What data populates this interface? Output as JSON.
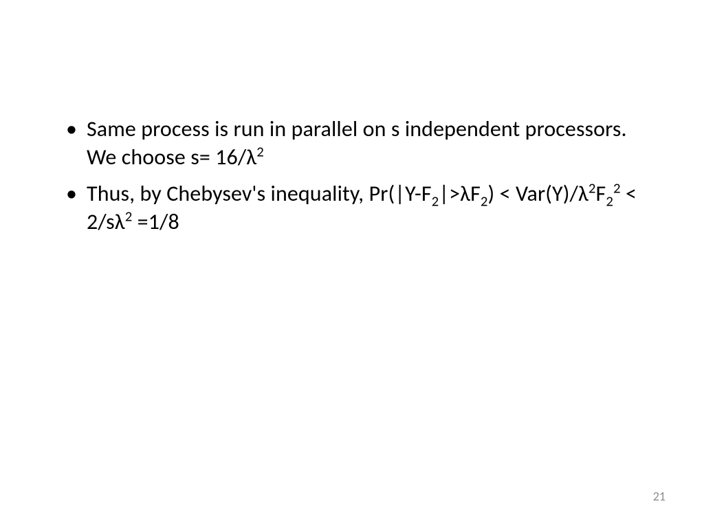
{
  "bullets": [
    {
      "b1_a": "Same process is run in parallel on s independent processors. We choose s= 16/λ",
      "b1_sup1": "2"
    },
    {
      "b2_a": "Thus, by Chebysev's inequality, Pr(|Y-F",
      "b2_sub1": "2",
      "b2_b": "|>λF",
      "b2_sub2": "2",
      "b2_c": ") < Var(Y)/λ",
      "b2_sup1": "2",
      "b2_d": "F",
      "b2_sub3": "2",
      "b2_sup2": "2",
      "b2_e": " < 2/sλ",
      "b2_sup3": "2",
      "b2_f": " =1/8"
    }
  ],
  "page_number": "21"
}
